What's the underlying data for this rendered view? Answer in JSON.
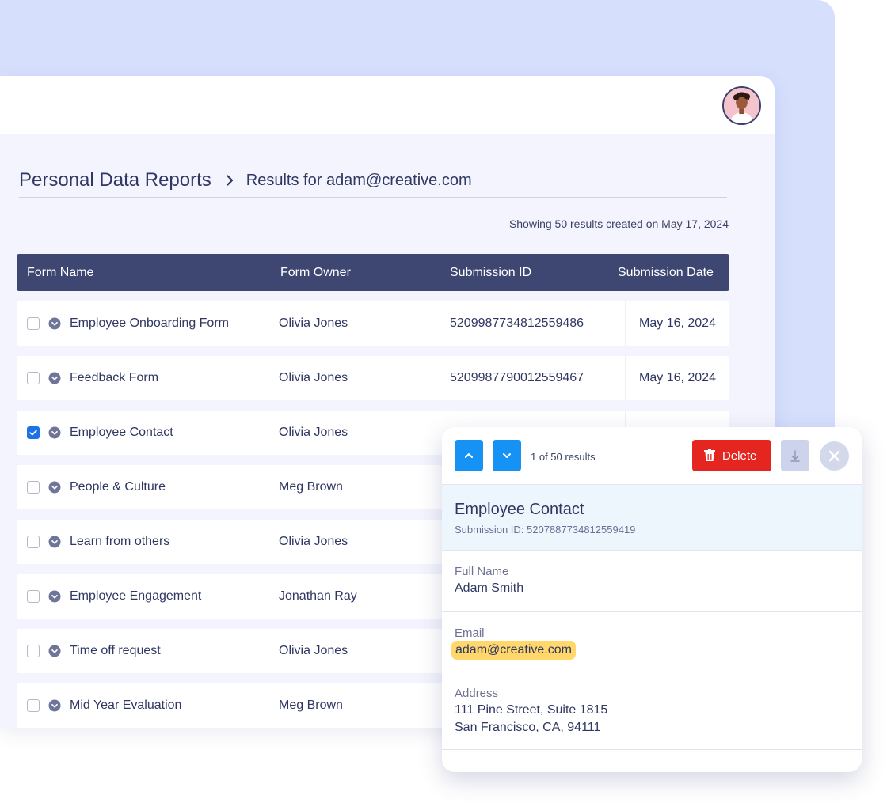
{
  "breadcrumb": {
    "main": "Personal Data Reports",
    "sub": "Results for adam@creative.com"
  },
  "summary": "Showing 50 results created on May 17, 2024",
  "table": {
    "headers": [
      "Form Name",
      "Form Owner",
      "Submission ID",
      "Submission Date"
    ],
    "rows": [
      {
        "name": "Employee Onboarding Form",
        "owner": "Olivia Jones",
        "id": "5209987734812559486",
        "date": "May 16, 2024",
        "checked": false
      },
      {
        "name": "Feedback Form",
        "owner": "Olivia Jones",
        "id": "5209987790012559467",
        "date": "May 16, 2024",
        "checked": false
      },
      {
        "name": "Employee Contact",
        "owner": "Olivia Jones",
        "id": "",
        "date": "",
        "checked": true
      },
      {
        "name": "People & Culture",
        "owner": "Meg Brown",
        "id": "",
        "date": "",
        "checked": false
      },
      {
        "name": "Learn from others",
        "owner": "Olivia Jones",
        "id": "",
        "date": "",
        "checked": false
      },
      {
        "name": "Employee Engagement",
        "owner": "Jonathan Ray",
        "id": "",
        "date": "",
        "checked": false
      },
      {
        "name": "Time off request",
        "owner": "Olivia Jones",
        "id": "",
        "date": "",
        "checked": false
      },
      {
        "name": "Mid Year Evaluation",
        "owner": "Meg Brown",
        "id": "",
        "date": "",
        "checked": false
      }
    ]
  },
  "detail": {
    "results_count": "1 of 50 results",
    "delete_label": "Delete",
    "title": "Employee Contact",
    "submission": "Submission ID: 5207887734812559419",
    "fields": {
      "full_name_label": "Full Name",
      "full_name_value": "Adam Smith",
      "email_label": "Email",
      "email_value": "adam@creative.com",
      "address_label": "Address",
      "address_line1": "111 Pine Street, Suite 1815",
      "address_line2": "San Francisco, CA, 94111"
    }
  },
  "icons": {
    "avatar": "user-avatar",
    "breadcrumb_sep": "chevron-right-icon",
    "row_expand": "chevron-down-circle-icon",
    "prev": "chevron-up-icon",
    "next": "chevron-down-icon",
    "delete": "trash-icon",
    "download": "download-icon",
    "close": "close-icon"
  },
  "colors": {
    "header_bg": "#3d4771",
    "accent_blue": "#1592f4",
    "checkbox_blue": "#1d73e5",
    "delete_red": "#e5251f",
    "highlight_yellow": "#ffd76b",
    "backdrop": "#d6e0fd"
  }
}
